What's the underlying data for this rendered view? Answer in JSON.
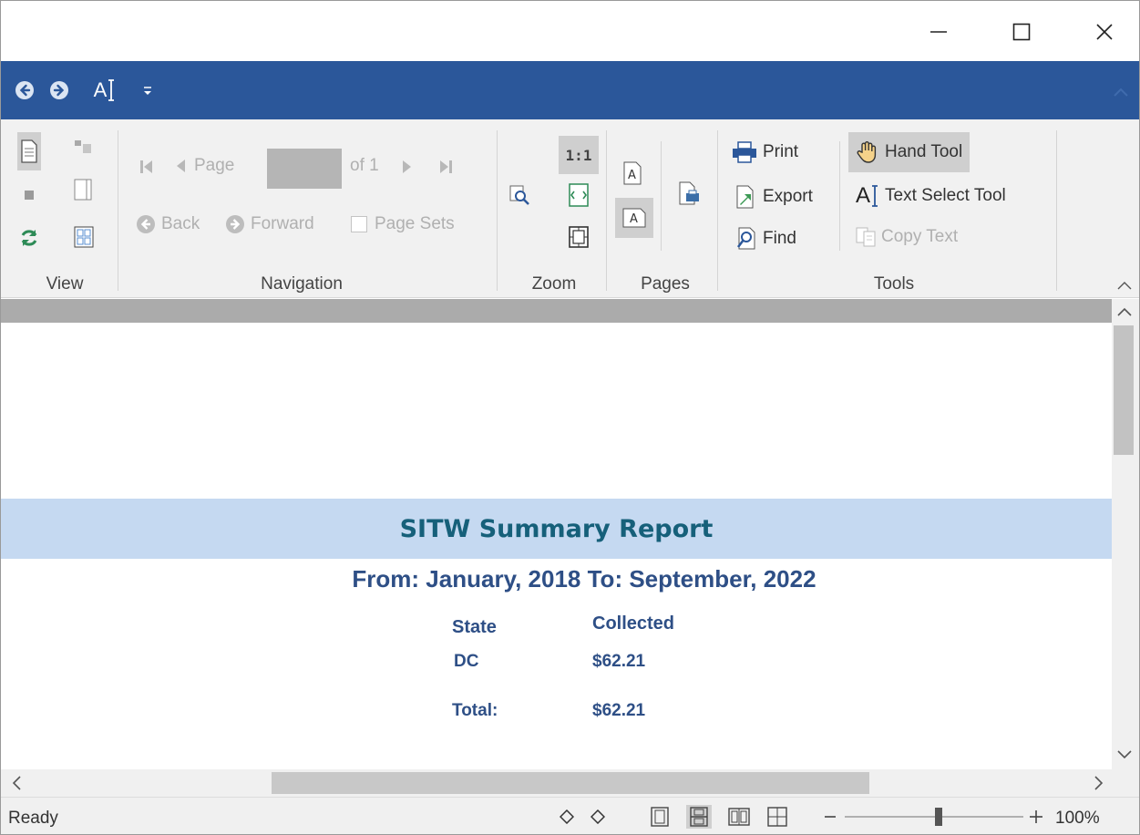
{
  "window": {
    "minimize_icon": "minimize-icon",
    "maximize_icon": "maximize-icon",
    "close_icon": "close-icon"
  },
  "quick_access": {
    "back_icon": "arrow-left-circle-icon",
    "forward_icon": "arrow-right-circle-icon",
    "text_select_label": "A",
    "customize_icon": "customize-dropdown-icon",
    "accent": "#2b579a"
  },
  "ribbon": {
    "groups": {
      "view": "View",
      "navigation": "Navigation",
      "zoom": "Zoom",
      "pages": "Pages",
      "tools": "Tools"
    },
    "navigation": {
      "page_label": "Page",
      "page_value": "",
      "of_label": "of 1",
      "back_label": "Back",
      "forward_label": "Forward",
      "page_sets_label": "Page Sets"
    },
    "zoom": {
      "actual_size_label": "1:1"
    },
    "tools": {
      "print_label": "Print",
      "export_label": "Export",
      "find_label": "Find",
      "hand_tool_label": "Hand Tool",
      "text_select_label": "Text Select Tool",
      "copy_text_label": "Copy Text"
    }
  },
  "report": {
    "title": "SITW Summary Report",
    "date_range": "From: January, 2018  To: September, 2022",
    "header_band_color": "#c5d9f1",
    "columns": [
      "State",
      "Collected"
    ],
    "rows": [
      {
        "state": "DC",
        "collected": "$62.21"
      }
    ],
    "total_label": "Total:",
    "total_value": "$62.21"
  },
  "status": {
    "text": "Ready",
    "zoom_percent": "100%",
    "zoom_slider_level": 100
  }
}
